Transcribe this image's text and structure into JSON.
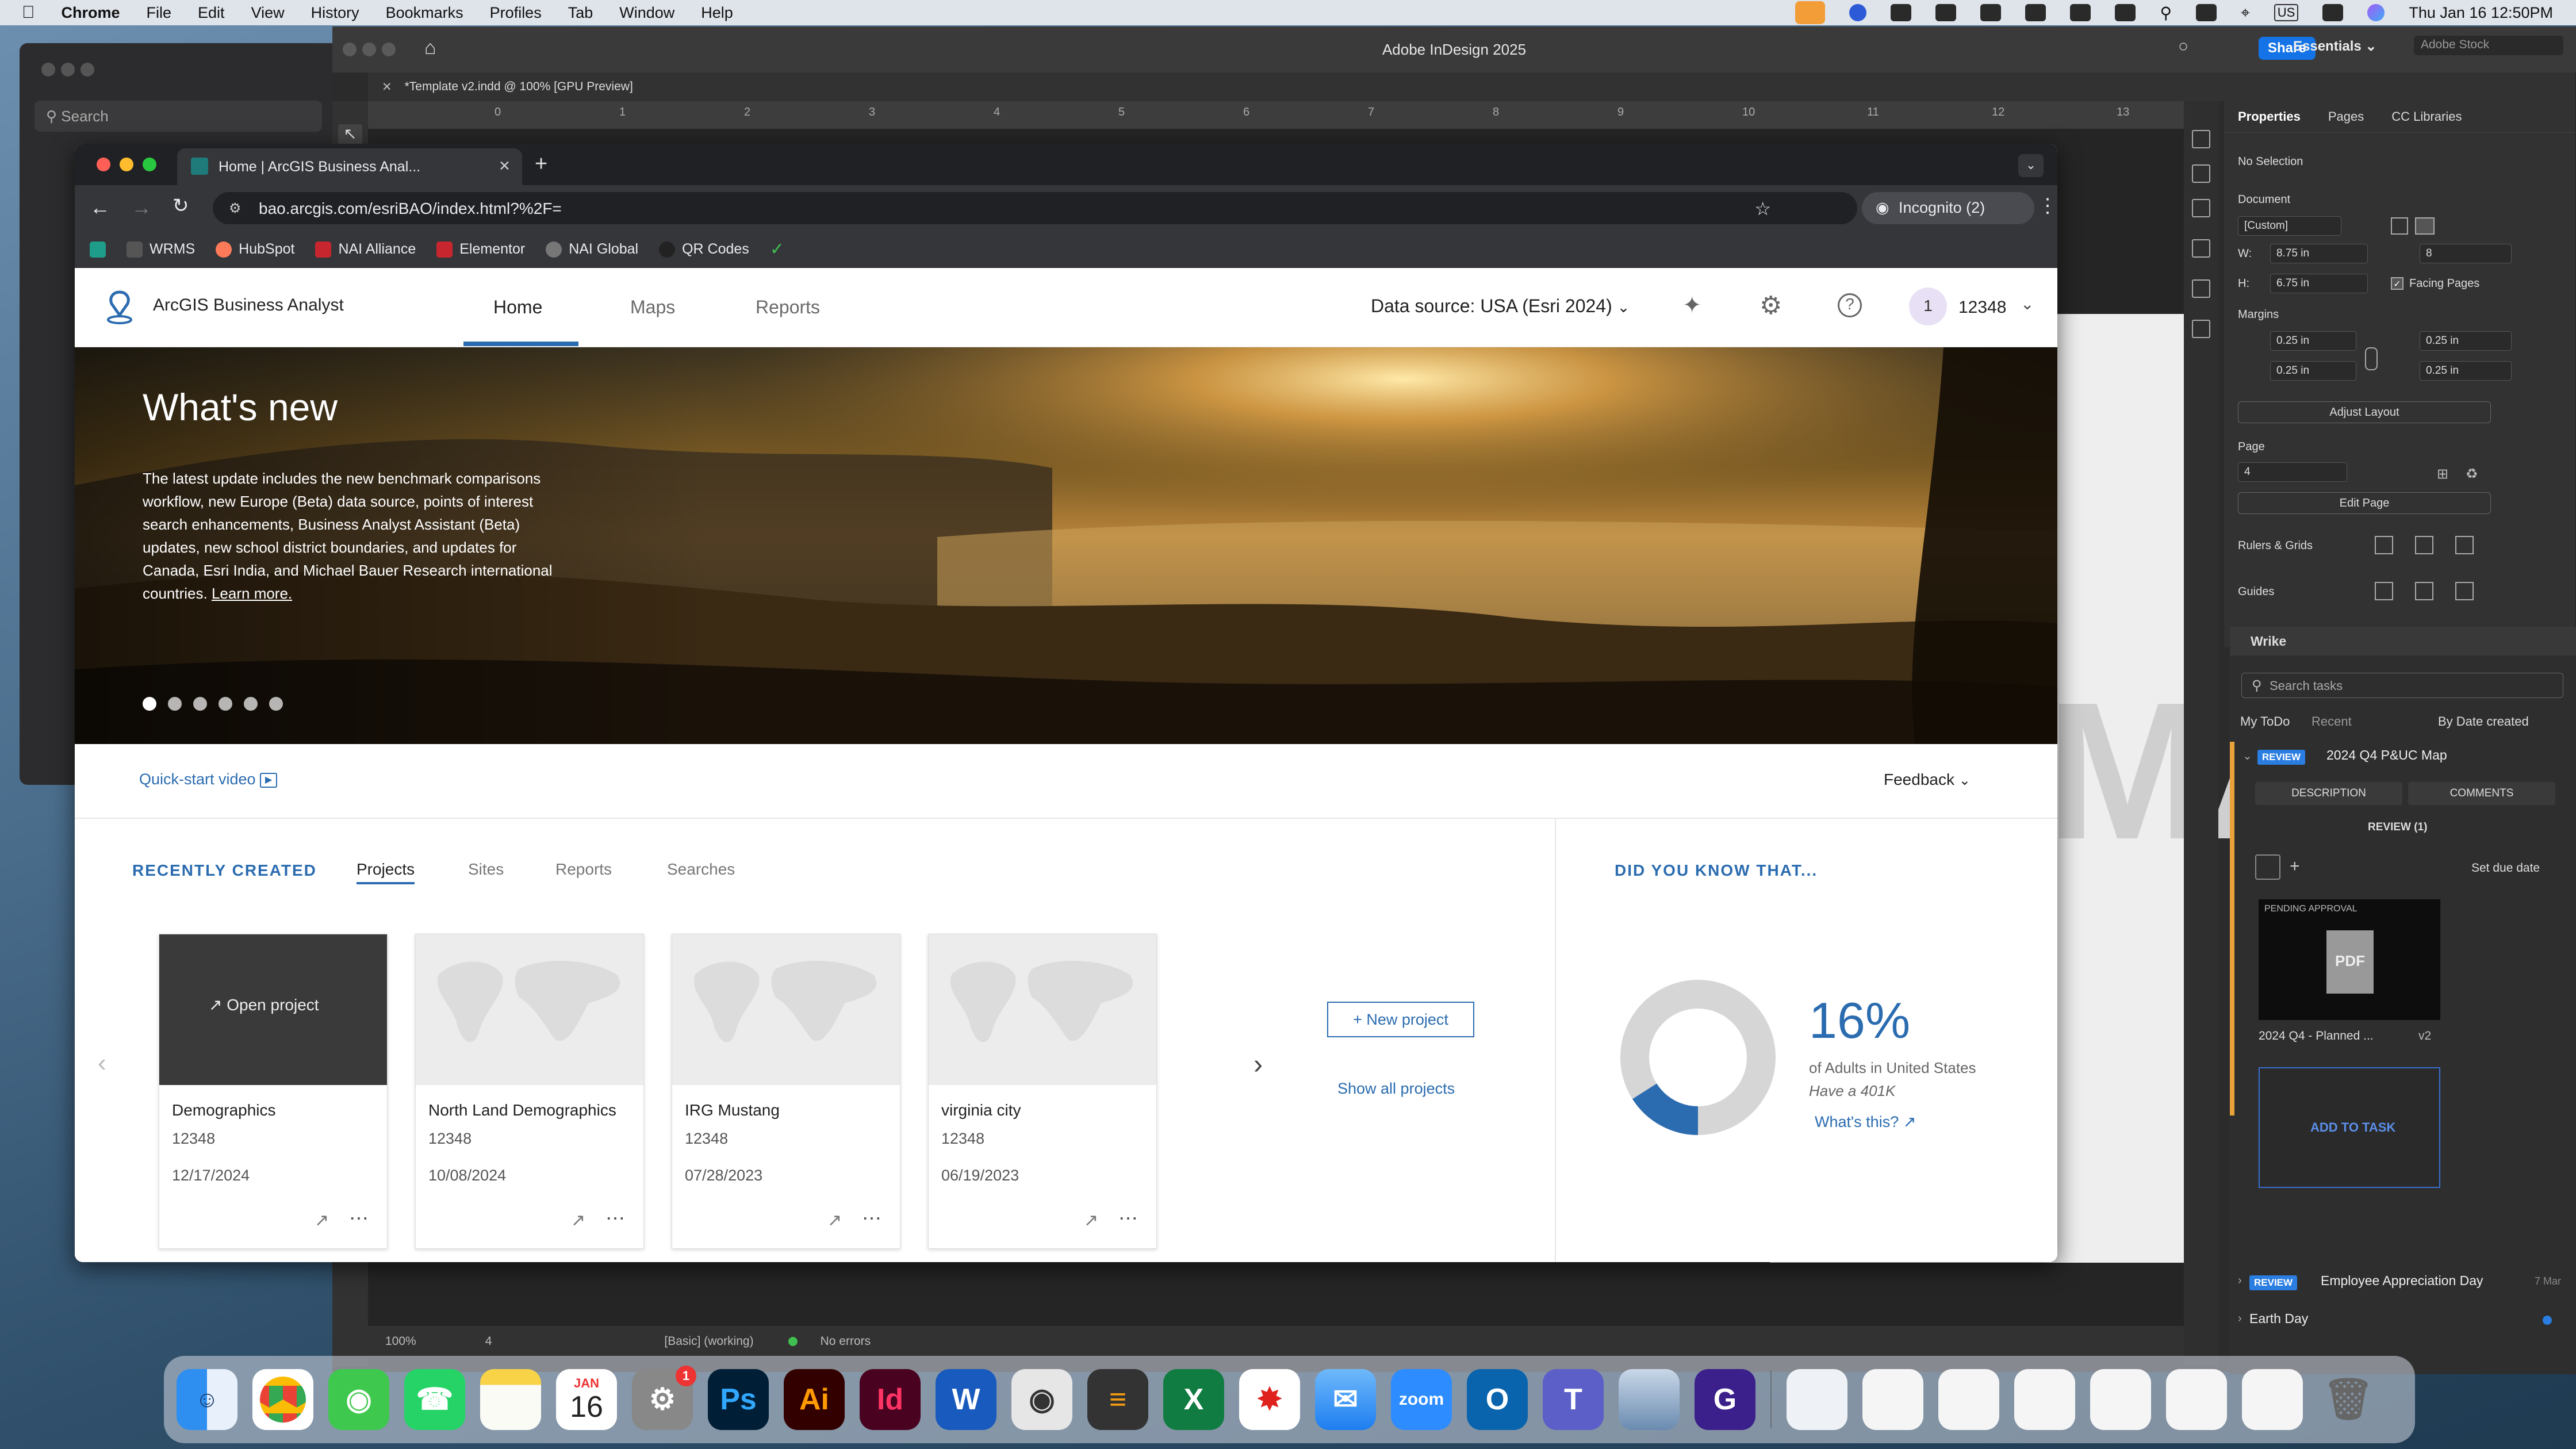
{
  "menubar": {
    "app_name": "Chrome",
    "items": [
      "File",
      "Edit",
      "View",
      "History",
      "Bookmarks",
      "Profiles",
      "Tab",
      "Window",
      "Help"
    ],
    "clock": "Thu Jan 16  12:50PM",
    "input_source": "US"
  },
  "indesign": {
    "window_title": "Adobe InDesign 2025",
    "share_label": "Share",
    "workspace": "Essentials",
    "stock_placeholder": "Adobe Stock",
    "doc_tab": "*Template v2.indd @ 100% [GPU Preview]",
    "ruler_numbers": [
      "0",
      "1",
      "2",
      "3",
      "4",
      "5",
      "6",
      "7",
      "8",
      "9",
      "10",
      "11",
      "12",
      "13"
    ],
    "big_text": "MA",
    "status": {
      "zoom": "100%",
      "page": "4",
      "style": "[Basic] (working)",
      "errors": "No errors"
    },
    "properties": {
      "tabs": [
        "Properties",
        "Pages",
        "CC Libraries"
      ],
      "selection": "No Selection",
      "document_label": "Document",
      "preset": "[Custom]",
      "w_label": "W:",
      "w_value": "8.75 in",
      "h_label": "H:",
      "h_value": "6.75 in",
      "pages_value": "8",
      "facing_pages": "Facing Pages",
      "margins_label": "Margins",
      "margin_top": "0.25 in",
      "margin_bottom": "0.25 in",
      "margin_left": "0.25 in",
      "margin_right": "0.25 in",
      "adjust_layout": "Adjust Layout",
      "page_label": "Page",
      "page_value": "4",
      "edit_page": "Edit Page",
      "rulers_grids": "Rulers & Grids",
      "guides": "Guides"
    },
    "wrike": {
      "title": "Wrike",
      "search_placeholder": "Search tasks",
      "tab_todo": "My ToDo",
      "tab_recent": "Recent",
      "sort": "By Date created",
      "task1_badge": "REVIEW",
      "task1_title": "2024 Q4 P&UC Map",
      "description_btn": "DESCRIPTION",
      "comments_btn": "COMMENTS",
      "review_count": "REVIEW (1)",
      "set_due": "Set due date",
      "pending": "PENDING APPROVAL",
      "pdf_label": "PDF",
      "file_name": "2024 Q4 - Planned ...",
      "file_version": "v2",
      "add_to_task": "ADD TO TASK",
      "task2_badge": "REVIEW",
      "task2_title": "Employee Appreciation Day",
      "task2_date": "7 Mar",
      "task3_title": "Earth Day"
    }
  },
  "finder_search": "Search",
  "chrome": {
    "tab_title": "Home | ArcGIS Business Anal...",
    "url": "bao.arcgis.com/esriBAO/index.html?%2F=",
    "incognito": "Incognito (2)",
    "bookmarks": [
      "WRMS",
      "HubSpot",
      "NAI Alliance",
      "Elementor",
      "NAI Global",
      "QR Codes"
    ]
  },
  "arcgis": {
    "app_name": "ArcGIS Business Analyst",
    "nav": [
      "Home",
      "Maps",
      "Reports"
    ],
    "data_source": "Data source: USA (Esri 2024)",
    "user_initial": "1",
    "user_name": "12348",
    "hero_title": "What's new",
    "hero_body": "The latest update includes the new benchmark comparisons workflow, new Europe (Beta) data source, points of interest search enhancements, Business Analyst Assistant (Beta) updates, new school district boundaries, and updates for Canada, Esri India, and Michael Bauer Research international countries.",
    "hero_link": "Learn more.",
    "carousel_dots": 6,
    "quick_start": "Quick-start video",
    "feedback": "Feedback",
    "recently_created": "RECENTLY CREATED",
    "recent_tabs": [
      "Projects",
      "Sites",
      "Reports",
      "Searches"
    ],
    "open_project": "Open project",
    "projects": [
      {
        "name": "Demographics",
        "id": "12348",
        "date": "12/17/2024"
      },
      {
        "name": "North Land Demographics",
        "id": "12348",
        "date": "10/08/2024"
      },
      {
        "name": "IRG Mustang",
        "id": "12348",
        "date": "07/28/2023"
      },
      {
        "name": "virginia city",
        "id": "12348",
        "date": "06/19/2023"
      }
    ],
    "new_project": "New project",
    "show_all": "Show all projects",
    "did_you_know": "DID YOU KNOW THAT...",
    "stat_percent": "16%",
    "stat_fraction": 0.16,
    "stat_desc": "of Adults in United States",
    "stat_sub": "Have a 401K",
    "whats_this": "What's this?"
  },
  "dock": {
    "calendar_month": "JAN",
    "calendar_day": "16",
    "settings_badge": "1",
    "apps": [
      "finder-icon",
      "chrome-icon",
      "messages-icon",
      "whatsapp-icon",
      "notes-icon",
      "calendar-icon",
      "settings-icon",
      "photoshop-icon",
      "illustrator-icon",
      "indesign-icon",
      "word-icon",
      "screenshot-icon",
      "calculator-icon",
      "excel-icon",
      "acrobat-icon",
      "mail-icon",
      "zoom-icon",
      "outlook-icon",
      "teams-icon",
      "preview-icon",
      "grammarly-icon"
    ],
    "labels": {
      "ps": "Ps",
      "ai": "Ai",
      "id": "Id",
      "word": "W",
      "excel": "X",
      "zoom": "zoom",
      "outlook": "O",
      "teams": "T",
      "grammarly": "G"
    }
  },
  "colors": {
    "esri_blue": "#2b6cb0",
    "accent_blue": "#3577c4",
    "donut_grey": "#d6d6d6",
    "wrike_badge": "#2a7de1"
  }
}
